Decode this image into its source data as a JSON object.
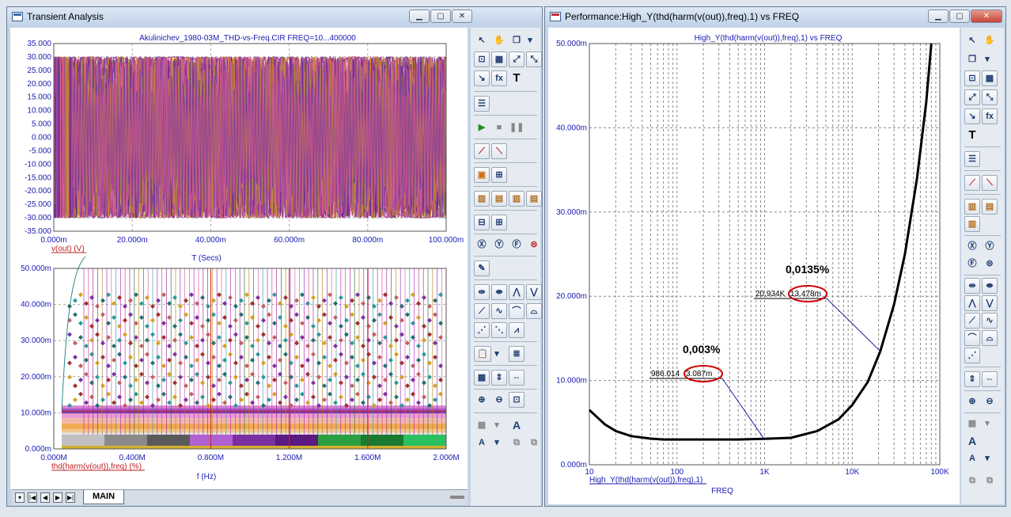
{
  "left_window": {
    "title": "Transient Analysis",
    "top_plot": {
      "title": "Akulinichev_1980-03M_THD-vs-Freq.CIR FREQ=10...400000",
      "y_ticks": [
        "35.000",
        "30.000",
        "25.000",
        "20.000",
        "15.000",
        "10.000",
        "5.000",
        "0.000",
        "-5.000",
        "-10.000",
        "-15.000",
        "-20.000",
        "-25.000",
        "-30.000",
        "-35.000"
      ],
      "x_ticks": [
        "0.000m",
        "20.000m",
        "40.000m",
        "60.000m",
        "80.000m",
        "100.000m"
      ],
      "trace_label": "v(out) (V)",
      "x_label": "T (Secs)"
    },
    "bottom_plot": {
      "y_ticks": [
        "50.000m",
        "40.000m",
        "30.000m",
        "20.000m",
        "10.000m",
        "0.000m"
      ],
      "x_ticks": [
        "0.000M",
        "0.400M",
        "0.800M",
        "1.200M",
        "1.600M",
        "2.000M"
      ],
      "trace_label": "thd(harm(v(out)),freq) (%)",
      "x_label": "f (Hz)"
    },
    "tab": "MAIN"
  },
  "right_window": {
    "title": "Performance:High_Y(thd(harm(v(out)),freq),1) vs FREQ",
    "plot_title": "High_Y(thd(harm(v(out)),freq),1) vs FREQ",
    "y_ticks": [
      "50.000m",
      "40.000m",
      "30.000m",
      "20.000m",
      "10.000m",
      "0.000m"
    ],
    "x_ticks": [
      "10",
      "100",
      "1K",
      "10K",
      "100K"
    ],
    "trace_label": "High_Y(thd(harm(v(out)),freq),1)",
    "x_label": "FREQ",
    "annotations": [
      {
        "big": "0,0135%",
        "x_label": "20.934K",
        "y_label": "13.478m"
      },
      {
        "big": "0,003%",
        "x_label": "986.014",
        "y_label": "3.087m"
      }
    ]
  },
  "chart_data": [
    {
      "type": "line",
      "title": "High_Y(thd(harm(v(out)),freq),1) vs FREQ",
      "xlabel": "FREQ",
      "ylabel": "",
      "xscale": "log",
      "xlim": [
        10,
        100000
      ],
      "ylim": [
        0,
        0.05
      ],
      "grid": true,
      "series": [
        {
          "name": "High_Y(thd(harm(v(out)),freq),1)",
          "x": [
            10,
            15,
            20,
            30,
            50,
            70,
            100,
            200,
            500,
            986.014,
            2000,
            4000,
            7000,
            10000,
            15000,
            20934,
            30000,
            40000,
            55000,
            70000,
            80000
          ],
          "y": [
            0.0065,
            0.0048,
            0.004,
            0.0034,
            0.0031,
            0.003,
            0.003,
            0.003,
            0.003,
            0.003087,
            0.0032,
            0.004,
            0.0054,
            0.0071,
            0.0098,
            0.013478,
            0.019,
            0.025,
            0.034,
            0.043,
            0.05
          ]
        }
      ]
    },
    {
      "type": "line",
      "xlabel": "T (Secs)",
      "ylabel": "v(out) (V)",
      "xlim": [
        0,
        100
      ],
      "ylim": [
        -35,
        35
      ],
      "grid": true,
      "series": [
        {
          "name": "v(out) (V)",
          "amplitude": 30
        }
      ]
    },
    {
      "type": "scatter",
      "xlabel": "f (Hz)",
      "ylabel": "thd(harm(v(out)),freq) (%)",
      "xlim": [
        0,
        2.0
      ],
      "ylim": [
        0,
        0.05
      ],
      "grid": true
    }
  ],
  "colors": {
    "axis_text": "#1a1ab4",
    "trace_label": "#c02020",
    "marker_ellipse": "#cc0000",
    "curve": "#000000"
  }
}
